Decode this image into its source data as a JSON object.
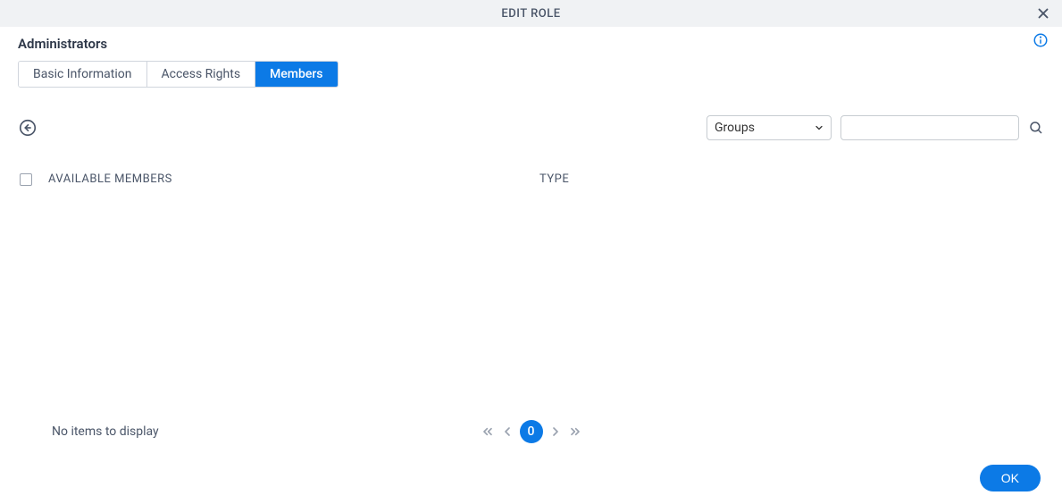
{
  "header": {
    "title": "EDIT ROLE"
  },
  "role_name": "Administrators",
  "tabs": [
    {
      "label": "Basic Information"
    },
    {
      "label": "Access Rights"
    },
    {
      "label": "Members"
    }
  ],
  "filter": {
    "selected": "Groups",
    "search_value": ""
  },
  "table": {
    "col_available_members": "AVAILABLE MEMBERS",
    "col_type": "TYPE",
    "empty_text": "No items to display"
  },
  "pagination": {
    "current": "0"
  },
  "buttons": {
    "ok": "OK"
  }
}
